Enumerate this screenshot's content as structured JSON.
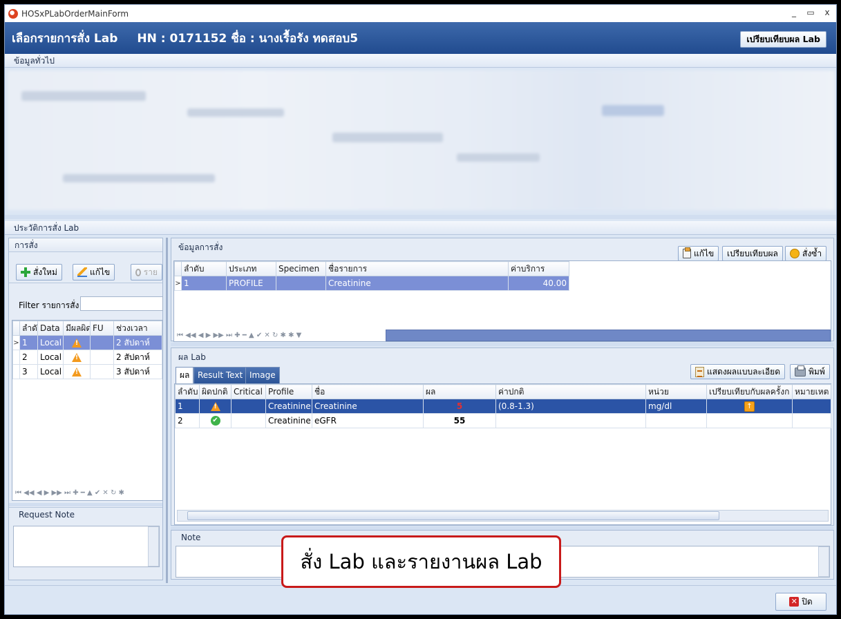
{
  "window": {
    "title": "HOSxPLabOrderMainForm",
    "controls": [
      "_",
      "▭",
      "x"
    ]
  },
  "header": {
    "title": "เลือกรายการสั่ง Lab",
    "patient": "HN : 0171152 ชื่อ : นางเรื้อรัง ทดสอบ5",
    "compare_button": "เปรียบเทียบผล Lab"
  },
  "general_info": {
    "title": "ข้อมูลทั่วไป"
  },
  "history": {
    "title": "ประวัติการสั่ง Lab"
  },
  "orders": {
    "title": "การสั่ง",
    "buttons": {
      "new": "สั่งใหม่",
      "edit": "แก้ไข",
      "report": "ราย"
    },
    "filter_label": "Filter รายการสั่ง",
    "filter_value": "",
    "columns": [
      "ลำดั",
      "Data S",
      "มีผลผิด",
      "FU",
      "ช่วงเวลา"
    ],
    "rows": [
      {
        "no": "1",
        "data": "Local",
        "flag": "warn",
        "fu": "",
        "period": "2 สัปดาห์"
      },
      {
        "no": "2",
        "data": "Local",
        "flag": "warn",
        "fu": "",
        "period": "2 สัปดาห์"
      },
      {
        "no": "3",
        "data": "Local",
        "flag": "warn",
        "fu": "",
        "period": "3 สัปดาห์"
      }
    ],
    "nav": "⏮ ◀◀ ◀ ▶ ▶▶ ⏭ ✚ ━ ▲ ✔ ✕ ↻ ✱"
  },
  "request_note": {
    "title": "Request Note",
    "value": ""
  },
  "order_info": {
    "title": "ข้อมูลการสั่ง",
    "buttons": {
      "edit": "แก้ไข",
      "compare": "เปรียบเทียบผล",
      "reorder": "สั่งซ้ำ"
    },
    "columns": [
      "ลำดับ",
      "ประเภท",
      "Specimen",
      "ชื่อรายการ",
      "ค่าบริการ"
    ],
    "rows": [
      {
        "no": "1",
        "type": "PROFILE",
        "specimen": "",
        "name": "Creatinine",
        "price": "40.00"
      }
    ],
    "nav": "⏮ ◀◀ ◀ ▶ ▶▶ ⏭ ✚ ━ ▲ ✔ ✕ ↻ ✱ ✱ ▼"
  },
  "lab_result": {
    "title": "ผล Lab",
    "tabs": [
      "ผล",
      "Result Text",
      "Image"
    ],
    "buttons": {
      "detail": "แสดงผลแบบละเอียด",
      "print": "พิมพ์"
    },
    "columns": [
      "ลำดับ",
      "ผิดปกติ",
      "Critical",
      "Profile",
      "ชื่อ",
      "ผล",
      "ค่าปกติ",
      "หน่วย",
      "เปรียบเทียบกับผลครั้งก",
      "หมายเหต"
    ],
    "rows": [
      {
        "no": "1",
        "abnormal": "warn",
        "critical": "",
        "profile": "Creatinine",
        "name": "Creatinine",
        "result": "5",
        "normal": "(0.8-1.3)",
        "unit": "mg/dl",
        "compare": "up",
        "remark": ""
      },
      {
        "no": "2",
        "abnormal": "ok",
        "critical": "",
        "profile": "Creatinine",
        "name": "eGFR",
        "result": "55",
        "normal": "",
        "unit": "",
        "compare": "",
        "remark": ""
      }
    ]
  },
  "note": {
    "title": "Note",
    "value": ""
  },
  "callout": "สั่ง Lab และรายงานผล Lab",
  "footer": {
    "close": "ปิด"
  },
  "colors": {
    "header": "#214b8f",
    "selected_row": "#7b8fd6",
    "callout_border": "#c81a1a",
    "warn": "#f39a1e",
    "ok": "#3fb34a"
  }
}
